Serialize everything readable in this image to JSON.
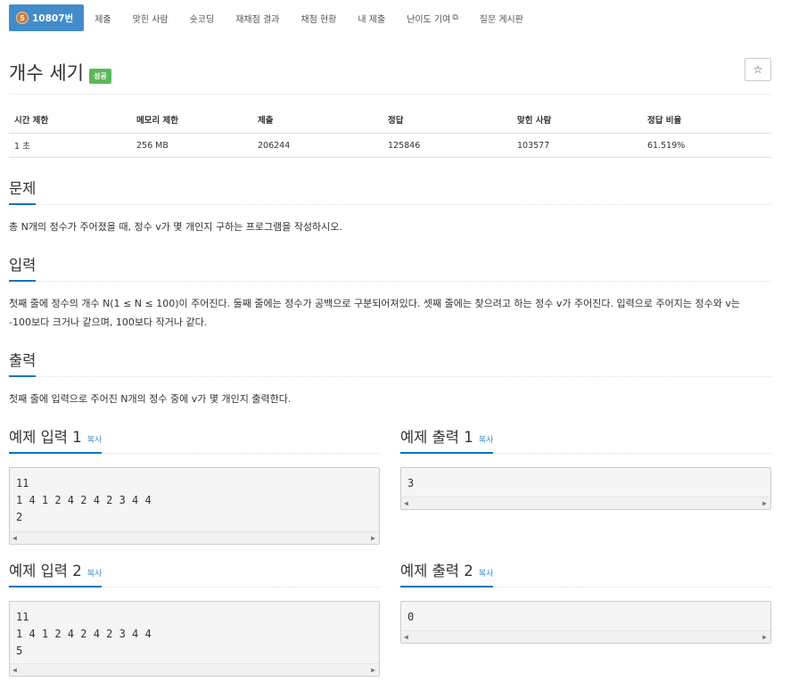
{
  "nav": {
    "problem_id": "10807번",
    "tier_icon_text": "5",
    "items": [
      "제출",
      "맞힌 사람",
      "숏코딩",
      "재채점 결과",
      "채점 현황",
      "내 제출",
      "난이도 기여",
      "질문 게시판"
    ]
  },
  "problem": {
    "title": "개수 세기",
    "status": "성공",
    "star": "☆"
  },
  "info": {
    "headers": [
      "시간 제한",
      "메모리 제한",
      "제출",
      "정답",
      "맞힌 사람",
      "정답 비율"
    ],
    "values": [
      "1 초",
      "256 MB",
      "206244",
      "125846",
      "103577",
      "61.519%"
    ]
  },
  "sections": {
    "description": {
      "heading": "문제",
      "text": "총 N개의 정수가 주어졌을 때, 정수 v가 몇 개인지 구하는 프로그램을 작성하시오."
    },
    "input": {
      "heading": "입력",
      "line1": "첫째 줄에 정수의 개수 N(1 ≤ N ≤ 100)이 주어진다. 둘째 줄에는 정수가 공백으로 구분되어져있다. 셋째 줄에는 찾으려고 하는 정수 v가 주어진다. 입력으로 주어지는 정수와 v는",
      "line2": "-100보다 크거나 같으며, 100보다 작거나 같다."
    },
    "output": {
      "heading": "출력",
      "text": "첫째 줄에 입력으로 주어진 N개의 정수 중에 v가 몇 개인지 출력한다."
    }
  },
  "samples": {
    "copy_label": "복사",
    "input1": {
      "heading": "예제 입력 1",
      "content": "11\n1 4 1 2 4 2 4 2 3 4 4\n2"
    },
    "output1": {
      "heading": "예제 출력 1",
      "content": "3"
    },
    "input2": {
      "heading": "예제 입력 2",
      "content": "11\n1 4 1 2 4 2 4 2 3 4 4\n5"
    },
    "output2": {
      "heading": "예제 출력 2",
      "content": "0"
    }
  },
  "icons": {
    "scroll_left": "◀",
    "scroll_right": "▶",
    "external_link": "⧉"
  },
  "colors": {
    "nav_active": "#428bca",
    "success": "#5cb85c",
    "heading_underline": "#0076c0",
    "link": "#428bca"
  }
}
